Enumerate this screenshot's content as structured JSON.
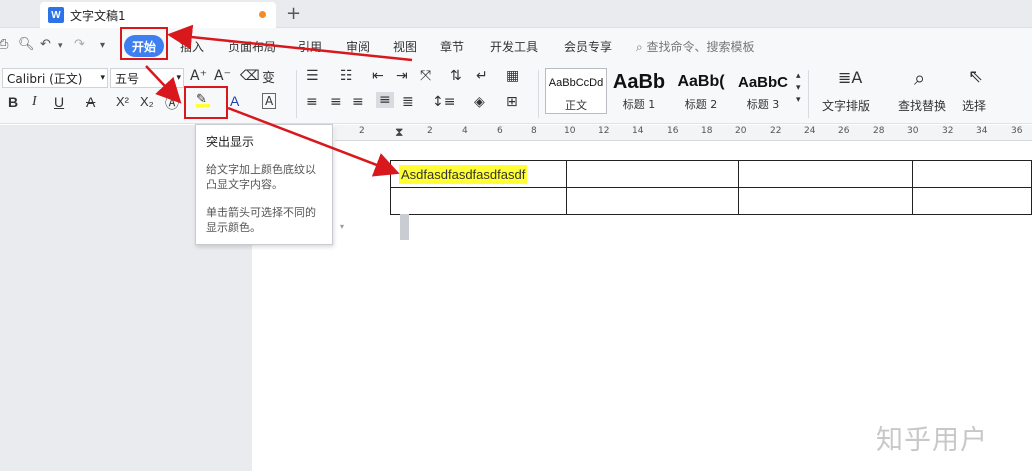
{
  "tabbar": {
    "doc_title": "文字文稿1",
    "app_badge": "W",
    "new_tab": "+"
  },
  "quick_access": {
    "undo": "↶",
    "redo": "↷",
    "more": "▾"
  },
  "menu": {
    "items": [
      "开始",
      "插入",
      "页面布局",
      "引用",
      "审阅",
      "视图",
      "章节",
      "开发工具",
      "会员专享"
    ],
    "search_placeholder": "查找命令、搜索模板"
  },
  "ribbon": {
    "font_name": "Calibri (正文)",
    "font_size": "五号",
    "bold": "B",
    "italic": "I",
    "underline": "U",
    "strike": "A",
    "superscript": "X²",
    "subscript": "X₂",
    "styles": [
      {
        "sample": "AaBbCcDd",
        "name": "正文"
      },
      {
        "sample": "AaBb",
        "name": "标题 1"
      },
      {
        "sample": "AaBb(",
        "name": "标题 2"
      },
      {
        "sample": "AaBbC",
        "name": "标题 3"
      }
    ],
    "text_layout": "文字排版",
    "find_replace": "查找替换",
    "select": "选择"
  },
  "ruler": {
    "labels": [
      "2",
      "2",
      "4",
      "6",
      "8",
      "10",
      "12",
      "14",
      "16",
      "18",
      "20",
      "22",
      "24",
      "26",
      "28",
      "30",
      "32",
      "34",
      "36"
    ]
  },
  "tooltip": {
    "title": "突出显示",
    "body": "给文字加上颜色底纹以凸显文字内容。",
    "hint": "单击箭头可选择不同的显示颜色。"
  },
  "table": {
    "cell_text": "Asdfasdfasdfasdfasdf"
  },
  "watermark": "知乎用户",
  "colors": {
    "accent": "#3d7ff0",
    "annotation_red": "#d9181e",
    "highlight": "#ffff33"
  }
}
